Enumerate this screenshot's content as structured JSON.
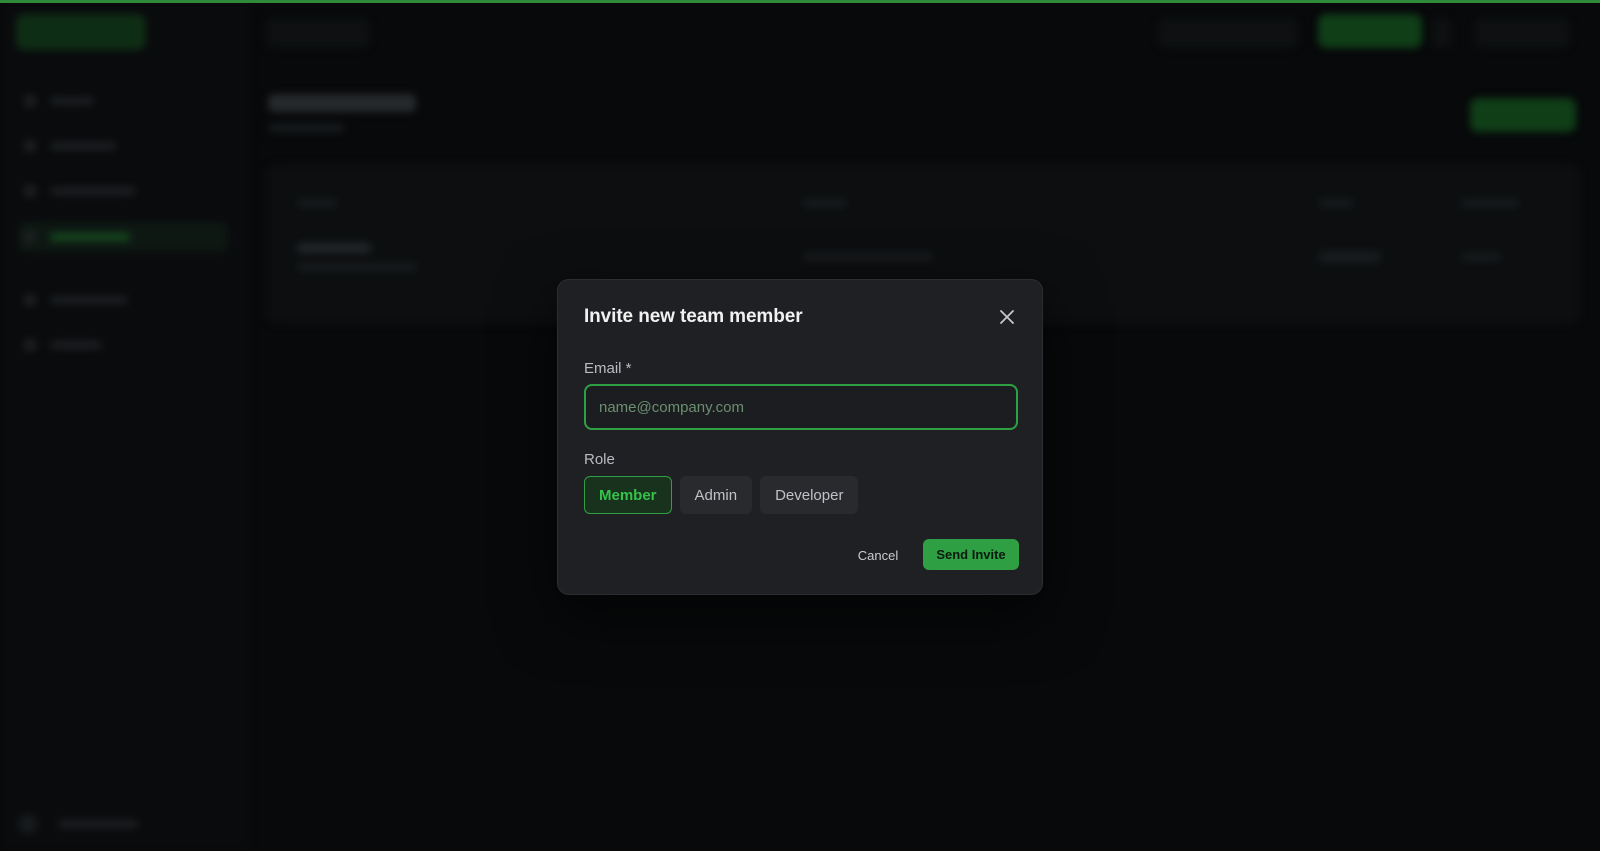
{
  "colors": {
    "accent": "#2ea043",
    "modal_background": "#1f2023",
    "page_background": "#0a0b0d"
  },
  "modal": {
    "title": "Invite new team member",
    "close_icon": "close-icon",
    "email": {
      "label": "Email *",
      "placeholder": "name@company.com",
      "value": ""
    },
    "role": {
      "label": "Role",
      "options": [
        "Member",
        "Admin",
        "Developer"
      ],
      "selected": "Member"
    },
    "cancel_label": "Cancel",
    "submit_label": "Send Invite"
  }
}
